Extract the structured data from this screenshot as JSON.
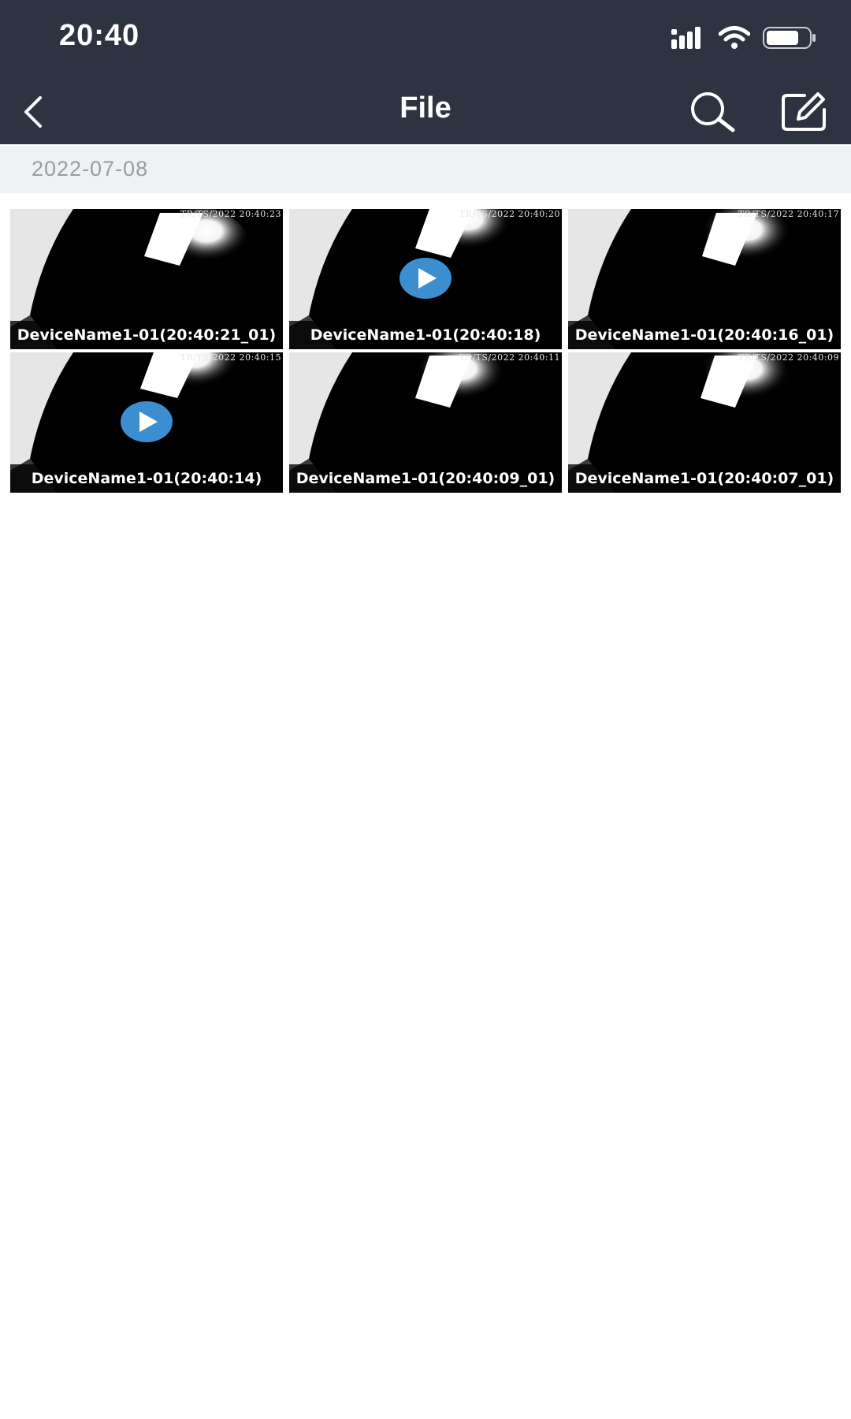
{
  "status_bar": {
    "time": "20:40"
  },
  "navbar": {
    "title": "File"
  },
  "date_header": "2022-07-08",
  "files": [
    {
      "caption": "DeviceName1-01(20:40:21_01)",
      "stamp": "TR/TS/2022 20:40:23",
      "video": false
    },
    {
      "caption": "DeviceName1-01(20:40:18)",
      "stamp": "TR/TS/2022 20:40:20",
      "video": true
    },
    {
      "caption": "DeviceName1-01(20:40:16_01)",
      "stamp": "TR/TS/2022 20:40:17",
      "video": false
    },
    {
      "caption": "DeviceName1-01(20:40:14)",
      "stamp": "TR/TS/2022 20:40:15",
      "video": true
    },
    {
      "caption": "DeviceName1-01(20:40:09_01)",
      "stamp": "TR/TS/2022 20:40:11",
      "video": false
    },
    {
      "caption": "DeviceName1-01(20:40:07_01)",
      "stamp": "TR/TS/2022 20:40:09",
      "video": false
    }
  ],
  "colors": {
    "header_bg": "#2d3341",
    "date_bar_bg": "#f0f1f4",
    "play_blue": "#3b8fd0"
  },
  "icons": [
    "back-icon",
    "search-icon",
    "edit-icon",
    "signal-icon",
    "wifi-icon",
    "battery-icon",
    "play-icon"
  ]
}
